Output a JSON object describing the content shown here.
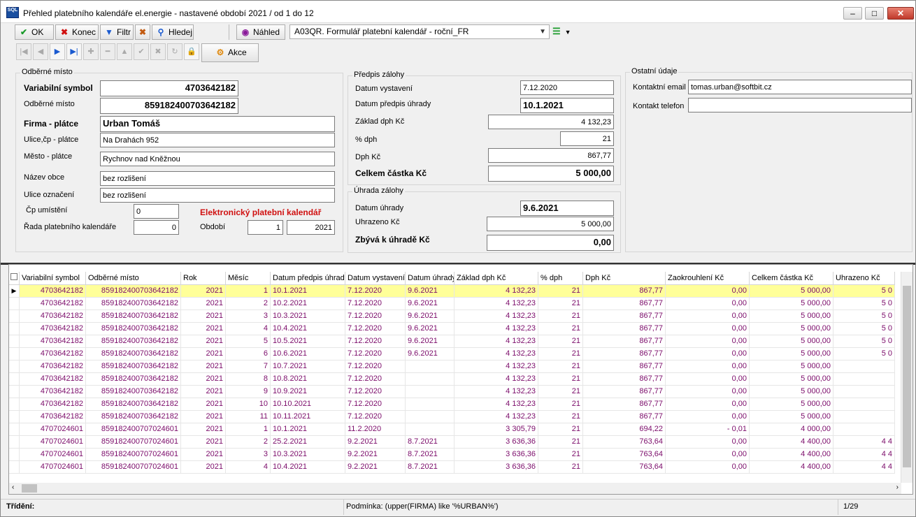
{
  "window": {
    "title": "Přehled platebního kalendáře el.energie - nastavené období 2021 / od 1 do 12",
    "app_icon": "SQL"
  },
  "toolbar": {
    "ok": "OK",
    "konec": "Konec",
    "filtr": "Filtr",
    "hledej": "Hledej",
    "nahled": "Náhled",
    "report": "A03QR.  Formulář platební kalendář  - roční_FR",
    "akce": "Akce"
  },
  "odberne": {
    "title": "Odběrné místo",
    "var_sym_label": "Variabilní symbol",
    "var_sym": "4703642182",
    "om_label": "Odběrné místo",
    "om": "859182400703642182",
    "firma_label": "Firma - plátce",
    "firma": "Urban Tomáš",
    "ulice_label": "Ulice,čp - plátce",
    "ulice": "Na Drahách 952",
    "mesto_label": "Město - plátce",
    "mesto": "Rychnov nad Kněžnou",
    "obec_label": "Název obce",
    "obec": "bez rozlišení",
    "ulice_ozn_label": "Ulice označení",
    "ulice_ozn": "bez rozlišení",
    "cp_label": "Čp umístění",
    "cp": "0",
    "rada_label": "Řada platebního kalendáře",
    "rada": "0",
    "epk": "Elektronický platební kalendář",
    "obdobi_label": "Období",
    "obdobi_m": "1",
    "obdobi_y": "2021"
  },
  "predpis": {
    "title": "Předpis zálohy",
    "vystaveni_label": "Datum vystavení",
    "vystaveni": "7.12.2020",
    "predpis_label": "Datum předpis úhrady",
    "predpis": "10.1.2021",
    "zaklad_label": "Základ dph Kč",
    "zaklad": "4 132,23",
    "dph_pct_label": "% dph",
    "dph_pct": "21",
    "dph_label": "Dph Kč",
    "dph": "867,77",
    "celkem_label": "Celkem částka Kč",
    "celkem": "5 000,00"
  },
  "uhrada": {
    "title": "Úhrada zálohy",
    "datum_label": "Datum úhrady",
    "datum": "9.6.2021",
    "uhrazeno_label": "Uhrazeno Kč",
    "uhrazeno": "5 000,00",
    "zbyva_label": "Zbývá k úhradě Kč",
    "zbyva": "0,00"
  },
  "ostatni": {
    "title": "Ostatní údaje",
    "email_label": "Kontaktní email",
    "email": "tomas.urban@softbit.cz",
    "tel_label": "Kontakt telefon",
    "tel": ""
  },
  "grid": {
    "columns": [
      "Variabilní symbol",
      "Odběrné místo",
      "Rok",
      "Měsíc",
      "Datum předpis úhrady",
      "Datum vystavení",
      "Datum úhrady",
      "Základ dph Kč",
      "% dph",
      "Dph Kč",
      "Zaokrouhlení Kč",
      "Celkem částka Kč",
      "Uhrazeno Kč"
    ],
    "rows": [
      [
        "4703642182",
        "859182400703642182",
        "2021",
        "1",
        "10.1.2021",
        "7.12.2020",
        "9.6.2021",
        "4 132,23",
        "21",
        "867,77",
        "0,00",
        "5 000,00",
        "5 0"
      ],
      [
        "4703642182",
        "859182400703642182",
        "2021",
        "2",
        "10.2.2021",
        "7.12.2020",
        "9.6.2021",
        "4 132,23",
        "21",
        "867,77",
        "0,00",
        "5 000,00",
        "5 0"
      ],
      [
        "4703642182",
        "859182400703642182",
        "2021",
        "3",
        "10.3.2021",
        "7.12.2020",
        "9.6.2021",
        "4 132,23",
        "21",
        "867,77",
        "0,00",
        "5 000,00",
        "5 0"
      ],
      [
        "4703642182",
        "859182400703642182",
        "2021",
        "4",
        "10.4.2021",
        "7.12.2020",
        "9.6.2021",
        "4 132,23",
        "21",
        "867,77",
        "0,00",
        "5 000,00",
        "5 0"
      ],
      [
        "4703642182",
        "859182400703642182",
        "2021",
        "5",
        "10.5.2021",
        "7.12.2020",
        "9.6.2021",
        "4 132,23",
        "21",
        "867,77",
        "0,00",
        "5 000,00",
        "5 0"
      ],
      [
        "4703642182",
        "859182400703642182",
        "2021",
        "6",
        "10.6.2021",
        "7.12.2020",
        "9.6.2021",
        "4 132,23",
        "21",
        "867,77",
        "0,00",
        "5 000,00",
        "5 0"
      ],
      [
        "4703642182",
        "859182400703642182",
        "2021",
        "7",
        "10.7.2021",
        "7.12.2020",
        "",
        "4 132,23",
        "21",
        "867,77",
        "0,00",
        "5 000,00",
        ""
      ],
      [
        "4703642182",
        "859182400703642182",
        "2021",
        "8",
        "10.8.2021",
        "7.12.2020",
        "",
        "4 132,23",
        "21",
        "867,77",
        "0,00",
        "5 000,00",
        ""
      ],
      [
        "4703642182",
        "859182400703642182",
        "2021",
        "9",
        "10.9.2021",
        "7.12.2020",
        "",
        "4 132,23",
        "21",
        "867,77",
        "0,00",
        "5 000,00",
        ""
      ],
      [
        "4703642182",
        "859182400703642182",
        "2021",
        "10",
        "10.10.2021",
        "7.12.2020",
        "",
        "4 132,23",
        "21",
        "867,77",
        "0,00",
        "5 000,00",
        ""
      ],
      [
        "4703642182",
        "859182400703642182",
        "2021",
        "11",
        "10.11.2021",
        "7.12.2020",
        "",
        "4 132,23",
        "21",
        "867,77",
        "0,00",
        "5 000,00",
        ""
      ],
      [
        "4707024601",
        "859182400707024601",
        "2021",
        "1",
        "10.1.2021",
        "11.2.2020",
        "",
        "3 305,79",
        "21",
        "694,22",
        "- 0,01",
        "4 000,00",
        ""
      ],
      [
        "4707024601",
        "859182400707024601",
        "2021",
        "2",
        "25.2.2021",
        "9.2.2021",
        "8.7.2021",
        "3 636,36",
        "21",
        "763,64",
        "0,00",
        "4 400,00",
        "4 4"
      ],
      [
        "4707024601",
        "859182400707024601",
        "2021",
        "3",
        "10.3.2021",
        "9.2.2021",
        "8.7.2021",
        "3 636,36",
        "21",
        "763,64",
        "0,00",
        "4 400,00",
        "4 4"
      ],
      [
        "4707024601",
        "859182400707024601",
        "2021",
        "4",
        "10.4.2021",
        "9.2.2021",
        "8.7.2021",
        "3 636,36",
        "21",
        "763,64",
        "0,00",
        "4 400,00",
        "4 4"
      ]
    ]
  },
  "status": {
    "trideni": "Třídění:",
    "podminka": "Podmínka: (upper(FIRMA) like '%URBAN%')",
    "pos": "1/29"
  }
}
